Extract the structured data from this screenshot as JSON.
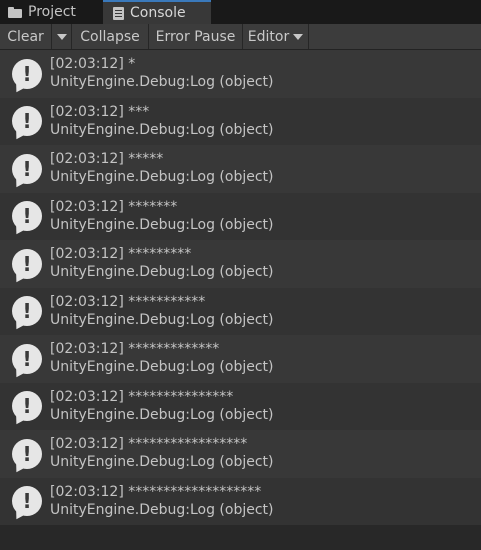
{
  "tabs": [
    {
      "label": "Project",
      "icon": "folder-icon"
    },
    {
      "label": "Console",
      "icon": "console-icon",
      "active": true
    }
  ],
  "toolbar": {
    "clear_label": "Clear",
    "collapse_label": "Collapse",
    "error_pause_label": "Error Pause",
    "editor_label": "Editor"
  },
  "colors": {
    "active_tab_accent": "#3a79bb",
    "row_odd": "#383838",
    "row_even": "#333333"
  },
  "logs": [
    {
      "message": "[02:03:12] *",
      "source": "UnityEngine.Debug:Log (object)",
      "icon": "info-bubble-icon"
    },
    {
      "message": "[02:03:12] ***",
      "source": "UnityEngine.Debug:Log (object)",
      "icon": "info-bubble-icon"
    },
    {
      "message": "[02:03:12] *****",
      "source": "UnityEngine.Debug:Log (object)",
      "icon": "info-bubble-icon"
    },
    {
      "message": "[02:03:12] *******",
      "source": "UnityEngine.Debug:Log (object)",
      "icon": "info-bubble-icon"
    },
    {
      "message": "[02:03:12] *********",
      "source": "UnityEngine.Debug:Log (object)",
      "icon": "info-bubble-icon"
    },
    {
      "message": "[02:03:12] ***********",
      "source": "UnityEngine.Debug:Log (object)",
      "icon": "info-bubble-icon"
    },
    {
      "message": "[02:03:12] *************",
      "source": "UnityEngine.Debug:Log (object)",
      "icon": "info-bubble-icon"
    },
    {
      "message": "[02:03:12] ***************",
      "source": "UnityEngine.Debug:Log (object)",
      "icon": "info-bubble-icon"
    },
    {
      "message": "[02:03:12] *****************",
      "source": "UnityEngine.Debug:Log (object)",
      "icon": "info-bubble-icon"
    },
    {
      "message": "[02:03:12] *******************",
      "source": "UnityEngine.Debug:Log (object)",
      "icon": "info-bubble-icon"
    }
  ]
}
